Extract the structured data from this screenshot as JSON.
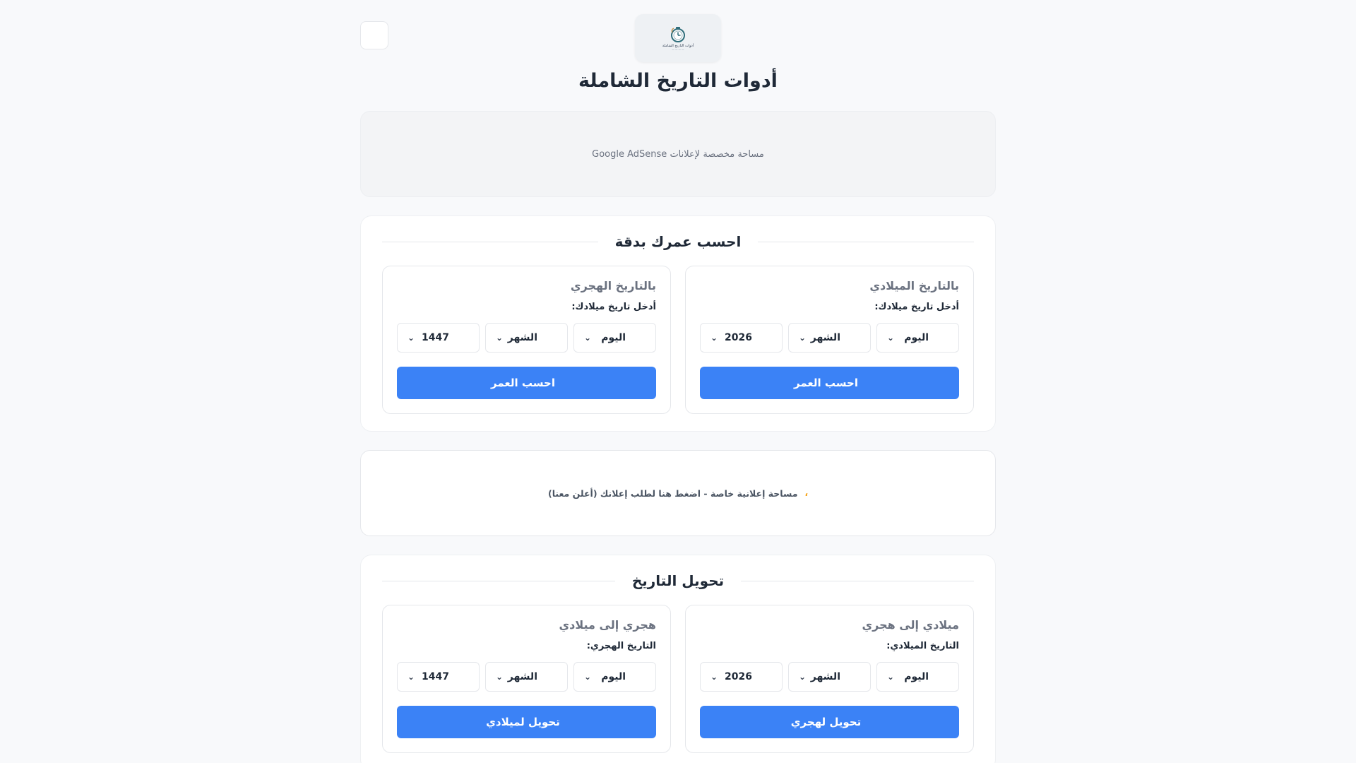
{
  "header": {
    "theme_toggle_glyph": "",
    "logo_text": "أدوات التاريخ الشاملة",
    "title": "أدوات التاريخ الشاملة"
  },
  "ad_slot": {
    "text": "مساحة مخصصة لإعلانات Google AdSense"
  },
  "age_section": {
    "title": "احسب عمرك بدقة",
    "gregorian": {
      "title": "بالتاريخ الميلادي",
      "label": "أدخل تاريخ ميلادك:",
      "day": "اليوم",
      "month": "الشهر",
      "year": "2026",
      "button": "احسب العمر",
      "button_icon": ""
    },
    "hijri": {
      "title": "بالتاريخ الهجري",
      "label": "أدخل تاريخ ميلادك:",
      "day": "اليوم",
      "month": "الشهر",
      "year": "1447",
      "button": "احسب العمر",
      "button_icon": ""
    }
  },
  "promo": {
    "text": "مساحة إعلانية خاصة - اضغط هنا لطلب إعلانك (أعلن معنا)",
    "icon": "،"
  },
  "convert_section": {
    "title": "تحويل التاريخ",
    "to_hijri": {
      "title": "ميلادي إلى هجري",
      "label": "التاريخ الميلادي:",
      "day": "اليوم",
      "month": "الشهر",
      "year": "2026",
      "button": "تحويل لهجري",
      "button_icon": ""
    },
    "to_gregorian": {
      "title": "هجري إلى ميلادي",
      "label": "التاريخ الهجري:",
      "day": "اليوم",
      "month": "الشهر",
      "year": "1447",
      "button": "تحويل لميلادي",
      "button_icon": ""
    }
  },
  "colors": {
    "primary": "#3b82f6",
    "background": "#f8f9fb",
    "accent_dot": "#f59e0b"
  }
}
